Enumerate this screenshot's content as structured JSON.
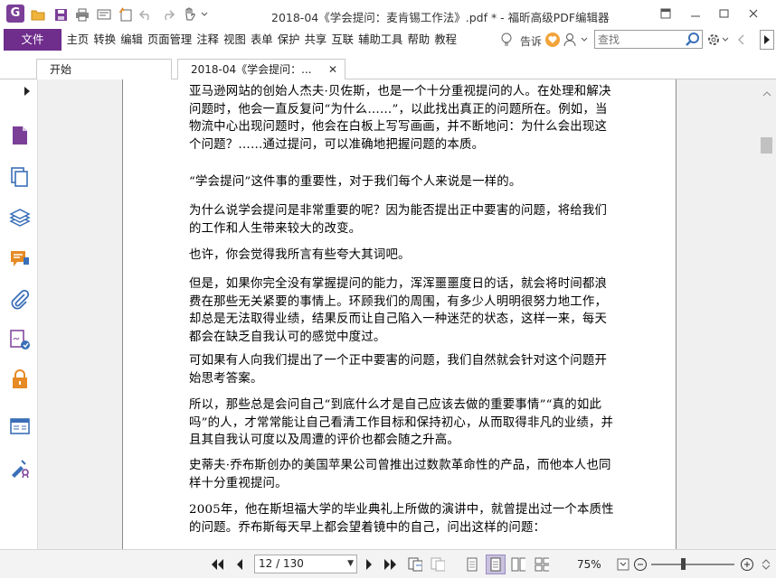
{
  "app": {
    "logo_letter": "G",
    "title": "2018-04《学会提问：麦肯锡工作法》.pdf * - 福昕高级PDF编辑器"
  },
  "menu": {
    "file_label": "文件",
    "items": [
      "主页",
      "转换",
      "编辑",
      "页面管理",
      "注释",
      "视图",
      "表单",
      "保护",
      "共享",
      "互联",
      "辅助工具",
      "帮助",
      "教程"
    ],
    "tell_label": "告诉",
    "search_placeholder": "查找"
  },
  "tabs": [
    {
      "label": "开始"
    },
    {
      "label": "2018-04《学会提问：...",
      "close": "✕"
    }
  ],
  "document": {
    "paragraphs": [
      "亚马逊网站的创始人杰夫·贝佐斯，也是一个十分重视提问的人。在处理和解决问题时，他会一直反复问“为什么……”，以此找出真正的问题所在。例如，当物流中心出现问题时，他会在白板上写写画画，并不断地问：为什么会出现这个问题？……通过提问，可以准确地把握问题的本质。",
      "“学会提问”这件事的重要性，对于我们每个人来说是一样的。",
      "为什么说学会提问是非常重要的呢？因为能否提出正中要害的问题，将给我们的工作和人生带来较大的改变。",
      "也许，你会觉得我所言有些夸大其词吧。",
      "但是，如果你完全没有掌握提问的能力，浑浑噩噩度日的话，就会将时间都浪费在那些无关紧要的事情上。环顾我们的周围，有多少人明明很努力地工作，却总是无法取得业绩，结果反而让自己陷入一种迷茫的状态，这样一来，每天都会在缺乏自我认可的感觉中度过。",
      "可如果有人向我们提出了一个正中要害的问题，我们自然就会针对这个问题开始思考答案。",
      "所以，那些总是会问自己“到底什么才是自己应该去做的重要事情”“真的如此吗”的人，才常常能让自己看清工作目标和保持初心，从而取得非凡的业绩，并且其自我认可度以及周遭的评价也都会随之升高。",
      "史蒂夫·乔布斯创办的美国苹果公司曾推出过数款革命性的产品，而他本人也同样十分重视提问。",
      "2005年，他在斯坦福大学的毕业典礼上所做的演讲中，就曾提出过一个本质性的问题。乔布斯每天早上都会望着镜中的自己，问出这样的问题："
    ]
  },
  "status": {
    "page_indicator": "12 / 130",
    "zoom": "75%",
    "zoom_level_percent": 75
  },
  "colors": {
    "accent": "#6f2d8c",
    "icon_blue": "#3a6fb7",
    "icon_purple": "#7b3f98",
    "icon_orange": "#e58a24"
  }
}
